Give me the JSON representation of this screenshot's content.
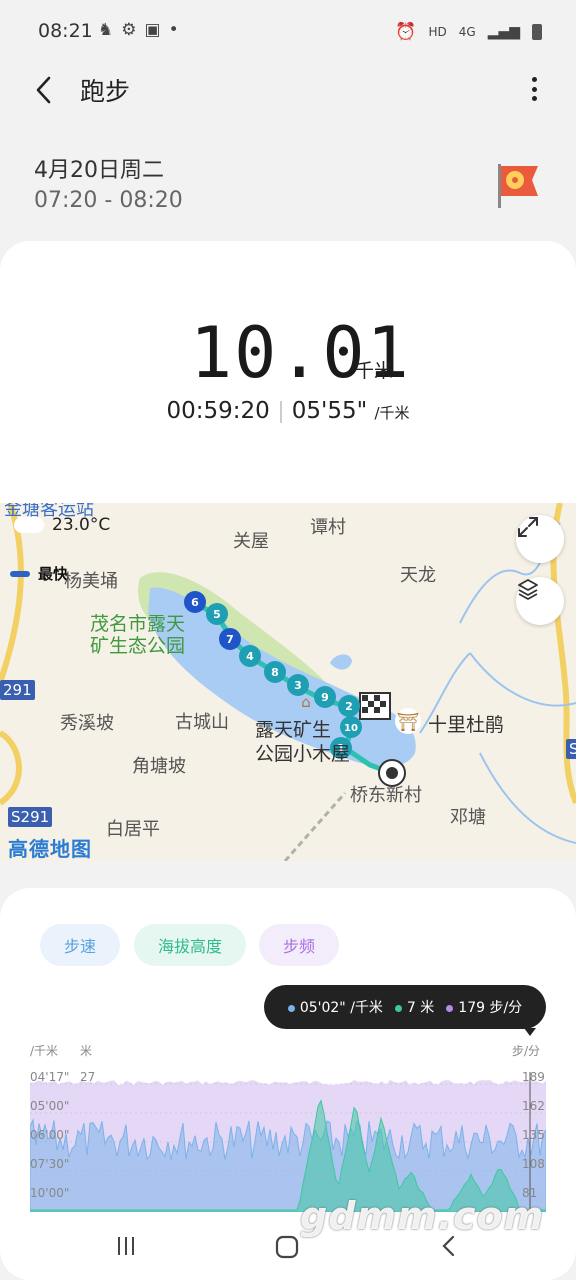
{
  "status_bar": {
    "time": "08:21",
    "network_label": "HD",
    "network_type": "4G"
  },
  "header": {
    "title": "跑步"
  },
  "workout": {
    "date": "4月20日周二",
    "time_range": "07:20 - 08:20",
    "distance": "10.01",
    "distance_unit": "千米",
    "duration": "00:59:20",
    "pace": "05'55\"",
    "pace_unit": "/千米"
  },
  "map": {
    "temperature": "23.0°C",
    "fastest_label": "最快",
    "provider_logo": "高德地图",
    "places": [
      "关屋",
      "谭村",
      "天龙",
      "杨美埇",
      "秀溪坡",
      "古城山",
      "角塘坡",
      "白居平",
      "邓塘",
      "桥东新村",
      "十里杜鹃"
    ],
    "park_name_line1": "茂名市露天",
    "park_name_line2": "矿生态公园",
    "cabin_line1": "露天矿生",
    "cabin_line2": "公园小木屋",
    "road_badges": [
      "S291",
      "S291",
      "291"
    ],
    "km_markers": [
      "6",
      "5",
      "7",
      "4",
      "8",
      "3",
      "9",
      "2",
      "10",
      "1"
    ],
    "top_partial_label": "金塘客运站"
  },
  "metrics": {
    "chips": [
      "步速",
      "海拔高度",
      "步频"
    ],
    "tooltip": {
      "pace": "05'02\" /千米",
      "altitude": "7 米",
      "cadence": "179 步/分"
    },
    "left_axis_unit": "/千米",
    "mid_axis_unit": "米",
    "right_axis_unit": "步/分",
    "pace_ticks": [
      "04'17\"",
      "05'00\"",
      "06'00\"",
      "07'30\"",
      "10'00\""
    ],
    "altitude_top": "27",
    "cadence_ticks": [
      "189",
      "162",
      "135",
      "108",
      "81"
    ]
  },
  "watermark": "gdmm.com",
  "colors": {
    "pace": "#7ab3ea",
    "altitude": "#3ec8a0",
    "cadence": "#b48be6",
    "route": "#2f8fe0",
    "lake": "#a9ccf5",
    "park": "#cfe6b0"
  }
}
